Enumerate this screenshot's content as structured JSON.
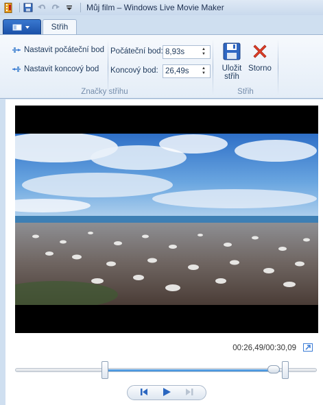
{
  "titlebar": {
    "title": "Můj film – Windows Live Movie Maker",
    "icons": [
      "app-icon",
      "save-icon",
      "undo-icon",
      "redo-icon",
      "customize-qat-icon"
    ]
  },
  "tabs": {
    "app_menu": "application-menu",
    "active_tab": "Střih"
  },
  "ribbon": {
    "markers_group": {
      "label": "Značky střihu",
      "set_start_label": "Nastavit počáteční bod",
      "set_end_label": "Nastavit koncový bod",
      "start_point_label": "Počáteční bod:",
      "start_point_value": "8,93s",
      "end_point_label": "Koncový bod:",
      "end_point_value": "26,49s"
    },
    "trim_group": {
      "label": "Střih",
      "save_line1": "Uložit",
      "save_line2": "střih",
      "cancel_label": "Storno"
    }
  },
  "preview": {
    "timecode": "00:26,49/00:30,09",
    "trim_start_fraction": 0.297,
    "trim_end_fraction": 0.88,
    "position_fraction": 0.88
  },
  "colors": {
    "accent": "#1a50a8",
    "selection": "#4f9ae0",
    "cancel_red": "#e0402a"
  }
}
